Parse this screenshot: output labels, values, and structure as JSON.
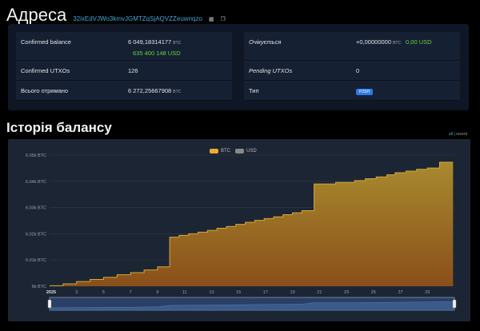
{
  "header": {
    "title": "Адреса",
    "address": "32ixEdVJWo3kmvJGMTZqSjAQVZZeuwnqzo",
    "qr_icon": "qr-code-icon",
    "copy_icon": "copy-icon"
  },
  "summary": {
    "left": [
      {
        "label": "Confirmed balance",
        "value": "6 049,18314177",
        "unit": "BTC",
        "usd": "635 400 148 USD"
      },
      {
        "label": "Confirmed UTXOs",
        "value": "126"
      },
      {
        "label": "Всього отримано",
        "value": "6 272,25667908",
        "unit": "BTC"
      }
    ],
    "right": [
      {
        "label": "Очікується",
        "value": "+0,00000000",
        "unit": "BTC",
        "usd": "0,00 USD"
      },
      {
        "label": "Pending UTXOs",
        "value": "0"
      },
      {
        "label": "Тип",
        "badge": "P2SH"
      }
    ]
  },
  "history": {
    "title": "Історія балансу",
    "zoom_all": "all",
    "zoom_sep": "|",
    "zoom_recent": "recent"
  },
  "chart_data": {
    "type": "area",
    "legend": [
      {
        "name": "BTC",
        "color": "#f0a830",
        "active": true
      },
      {
        "name": "USD",
        "color": "#888888",
        "active": false
      }
    ],
    "x_ticks": [
      "2025",
      "3",
      "5",
      "7",
      "9",
      "11",
      "13",
      "15",
      "17",
      "19",
      "21",
      "23",
      "25",
      "27",
      "29"
    ],
    "y_ticks": [
      "6k BTC",
      "6.01k BTC",
      "6.02k BTC",
      "6.03k BTC",
      "6.04k BTC",
      "6.05k BTC"
    ],
    "ylim": [
      6000,
      6050
    ],
    "x_range": [
      0,
      30
    ],
    "series": [
      {
        "name": "BTC",
        "points": [
          [
            0,
            6000.2
          ],
          [
            1,
            6000.9
          ],
          [
            2,
            6001.8
          ],
          [
            3,
            6002.6
          ],
          [
            4,
            6003.4
          ],
          [
            5,
            6004.4
          ],
          [
            6,
            6005.2
          ],
          [
            7,
            6006.2
          ],
          [
            8,
            6007.4
          ],
          [
            8.9,
            6018.7
          ],
          [
            9.6,
            6019.4
          ],
          [
            10.3,
            6020.0
          ],
          [
            11,
            6020.6
          ],
          [
            11.7,
            6021.3
          ],
          [
            12.4,
            6022.1
          ],
          [
            13.1,
            6022.8
          ],
          [
            13.8,
            6023.6
          ],
          [
            14.5,
            6024.4
          ],
          [
            15.2,
            6025.1
          ],
          [
            15.9,
            6025.8
          ],
          [
            16.6,
            6026.5
          ],
          [
            17.3,
            6027.3
          ],
          [
            18,
            6028.0
          ],
          [
            18.7,
            6028.8
          ],
          [
            19.6,
            6039.0
          ],
          [
            21.2,
            6039.6
          ],
          [
            22.6,
            6040.3
          ],
          [
            23.4,
            6041.0
          ],
          [
            24.2,
            6041.7
          ],
          [
            25,
            6042.5
          ],
          [
            25.6,
            6043.3
          ],
          [
            26.4,
            6043.9
          ],
          [
            27.2,
            6044.6
          ],
          [
            28,
            6045.1
          ],
          [
            28.9,
            6047.3
          ],
          [
            29.9,
            6047.3
          ]
        ]
      }
    ],
    "colors": {
      "fill_top": "#a88a2e",
      "fill_bottom": "#8a4f1a",
      "line": "#d4a93a",
      "grid": "#2e3a4b"
    }
  }
}
